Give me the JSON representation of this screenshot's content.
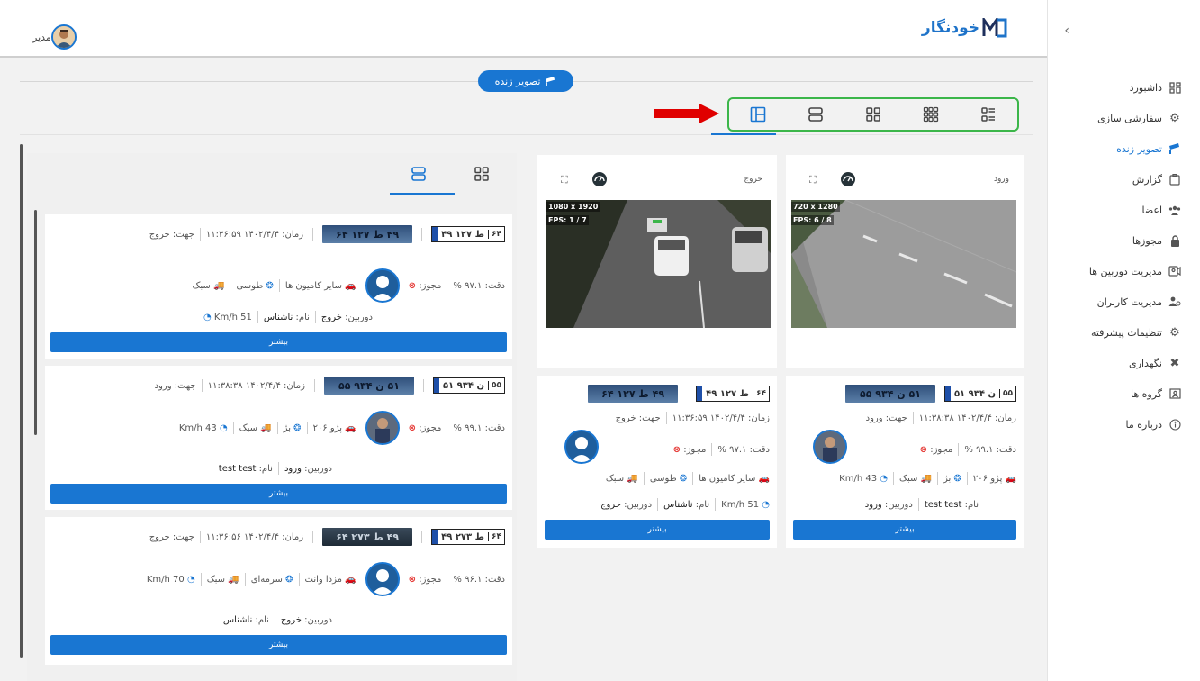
{
  "sidebar": {
    "items": [
      {
        "label": "داشبورد",
        "icon": "dashboard-icon"
      },
      {
        "label": "سفارشی سازی",
        "icon": "gear-icon"
      },
      {
        "label": "تصویر زنده",
        "icon": "camera-icon",
        "active": true
      },
      {
        "label": "گزارش",
        "icon": "report-icon"
      },
      {
        "label": "اعضا",
        "icon": "members-icon"
      },
      {
        "label": "مجوزها",
        "icon": "lock-icon"
      },
      {
        "label": "مدیریت دوربین ها",
        "icon": "camera-manage-icon"
      },
      {
        "label": "مدیریت کاربران",
        "icon": "users-icon"
      },
      {
        "label": "تنظیمات پیشرفته",
        "icon": "settings-advanced-icon"
      },
      {
        "label": "نگهداری",
        "icon": "tools-icon"
      },
      {
        "label": "گروه ها",
        "icon": "groups-icon"
      },
      {
        "label": "درباره ما",
        "icon": "info-icon"
      }
    ]
  },
  "header": {
    "logo_text": "خودنگار",
    "user_name": "مدیر"
  },
  "live_button": "تصویر زنده",
  "colors": {
    "accent": "#1976d2",
    "highlight": "#3cb64a",
    "arrow": "#e00000"
  },
  "cameras": [
    {
      "title": "ورود",
      "resolution": "720 x 1280",
      "fps": "FPS: 6 / 8"
    },
    {
      "title": "خروج",
      "resolution": "1080 x 1920",
      "fps": "FPS: 1 / 7"
    }
  ],
  "grid_cards": [
    {
      "plate_code": "۵۵",
      "plate_num": "۵۱ ن ۹۳۴",
      "plate_img": "۵۱ ن ۹۳۴ ۵۵",
      "time": "زمان: ۱۴۰۲/۴/۴ ۱۱:۳۸:۳۸",
      "direction": "جهت: ورود",
      "accuracy": "دقت: ۹۹.۱ %",
      "permit": "مجوز:",
      "vehicle": "پژو ۲۰۶",
      "color": "بژ",
      "type": "سبک",
      "speed": "43 Km/h",
      "name_label": "نام:",
      "name": "test test",
      "camera_label": "دوربین:",
      "camera": "ورود",
      "more": "بیشتر"
    },
    {
      "plate_code": "۶۴",
      "plate_num": "۴۹ ط ۱۲۷",
      "plate_img": "۴۹ ط ۱۲۷ ۶۴",
      "time": "زمان: ۱۴۰۲/۴/۴ ۱۱:۳۶:۵۹",
      "direction": "جهت: خروج",
      "accuracy": "دقت: ۹۷.۱ %",
      "permit": "مجوز:",
      "vehicle": "سایر کامیون ها",
      "color": "طوسی",
      "type": "سبک",
      "speed": "51 Km/h",
      "name_label": "نام:",
      "name": "ناشناس",
      "camera_label": "دوربین:",
      "camera": "خروج",
      "more": "بیشتر"
    }
  ],
  "list_cards": [
    {
      "plate_code": "۶۴",
      "plate_num": "۴۹ ط ۱۲۷",
      "plate_img": "۴۹ ط ۱۲۷ ۶۴",
      "time": "زمان: ۱۴۰۲/۴/۴ ۱۱:۳۶:۵۹",
      "direction": "جهت: خروج",
      "accuracy": "دقت: ۹۷.۱ %",
      "permit": "مجوز:",
      "vehicle": "سایر کامیون ها",
      "color": "طوسی",
      "type": "سبک",
      "speed": "51 Km/h",
      "name_label": "نام:",
      "name": "ناشناس",
      "camera_label": "دوربین:",
      "camera": "خروج",
      "more": "بیشتر"
    },
    {
      "plate_code": "۵۵",
      "plate_num": "۵۱ ن ۹۳۴",
      "plate_img": "۵۱ ن ۹۳۴ ۵۵",
      "time": "زمان: ۱۴۰۲/۴/۴ ۱۱:۳۸:۳۸",
      "direction": "جهت: ورود",
      "accuracy": "دقت: ۹۹.۱ %",
      "permit": "مجوز:",
      "vehicle": "پژو ۲۰۶",
      "color": "بژ",
      "type": "سبک",
      "speed": "43 Km/h",
      "name_label": "نام:",
      "name": "test test",
      "camera_label": "دوربین:",
      "camera": "ورود",
      "more": "بیشتر"
    },
    {
      "plate_code": "۶۴",
      "plate_num": "۴۹ ط ۲۷۳",
      "plate_img": "۴۹ ط ۲۷۳ ۶۴",
      "time": "زمان: ۱۴۰۲/۴/۴ ۱۱:۳۶:۵۶",
      "direction": "جهت: خروج",
      "accuracy": "دقت: ۹۶.۱ %",
      "permit": "مجوز:",
      "vehicle": "مزدا وانت",
      "color": "سرمه‌ای",
      "type": "سبک",
      "speed": "70 Km/h",
      "name_label": "نام:",
      "name": "ناشناس",
      "camera_label": "دوربین:",
      "camera": "خروج",
      "more": "بیشتر"
    }
  ]
}
